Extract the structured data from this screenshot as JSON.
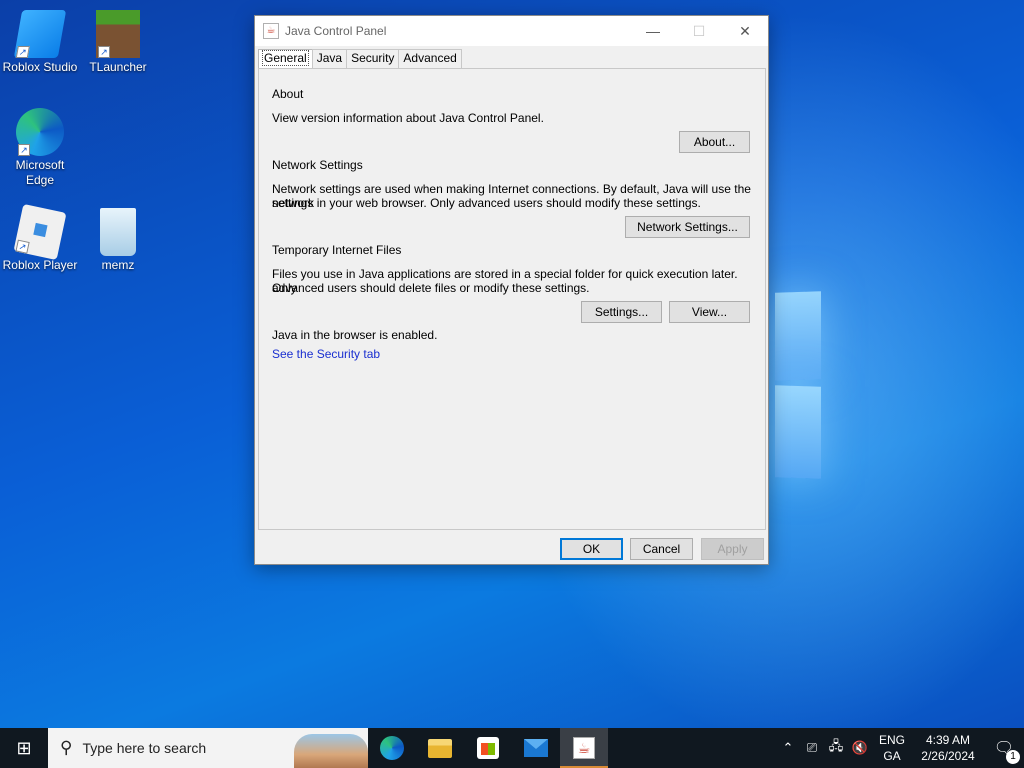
{
  "desktop": {
    "icons": [
      {
        "label": "Roblox Studio"
      },
      {
        "label": "TLauncher"
      },
      {
        "label": "Microsoft Edge"
      },
      {
        "label": "Roblox Player"
      },
      {
        "label": "memz"
      }
    ]
  },
  "window": {
    "title": "Java Control Panel",
    "controls": {
      "minimize": "—",
      "maximize": "☐",
      "close": "✕"
    },
    "tabs": [
      {
        "label": "General",
        "active": true
      },
      {
        "label": "Java"
      },
      {
        "label": "Security"
      },
      {
        "label": "Advanced"
      }
    ],
    "about": {
      "heading": "About",
      "text": "View version information about Java Control Panel.",
      "button": "About..."
    },
    "network": {
      "heading": "Network Settings",
      "text_line1": "Network settings are used when making Internet connections. By default, Java will use the network",
      "text_line2": "settings in your web browser. Only advanced users should modify these settings.",
      "button": "Network Settings..."
    },
    "temp_files": {
      "heading": "Temporary Internet Files",
      "text_line1": "Files you use in Java applications are stored in a special folder for quick execution later. Only",
      "text_line2": "advanced users should delete files or modify these settings.",
      "settings_button": "Settings...",
      "view_button": "View..."
    },
    "browser": {
      "status": "Java in the browser is enabled.",
      "link": "See the Security tab"
    },
    "footer": {
      "ok": "OK",
      "cancel": "Cancel",
      "apply": "Apply"
    }
  },
  "taskbar": {
    "search_placeholder": "Type here to search",
    "language": {
      "line1": "ENG",
      "line2": "GA"
    },
    "clock": {
      "time": "4:39 AM",
      "date": "2/26/2024"
    },
    "notification_count": "1"
  }
}
